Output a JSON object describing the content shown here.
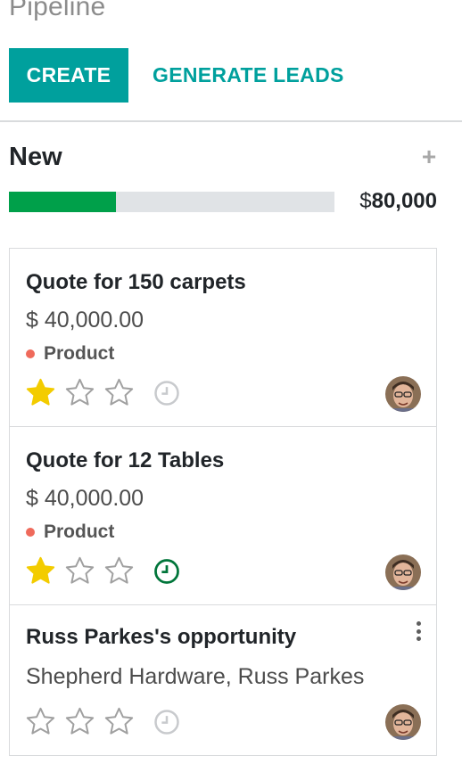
{
  "page": {
    "title": "Pipeline"
  },
  "toolbar": {
    "create_label": "CREATE",
    "generate_label": "GENERATE LEADS"
  },
  "column": {
    "title": "New",
    "add_icon": "plus-icon",
    "total_currency": "$",
    "total_amount": "80,000",
    "progress_fraction": 0.33,
    "progress_color": "#00a04a"
  },
  "cards": [
    {
      "title": "Quote for 150 carpets",
      "amount": "$ 40,000.00",
      "tag": "Product",
      "tag_color": "#ef6a5b",
      "stars_filled": 1,
      "stars_total": 3,
      "activity_status": "none",
      "activity_color": "#c8cacd"
    },
    {
      "title": "Quote for 12 Tables",
      "amount": "$ 40,000.00",
      "tag": "Product",
      "tag_color": "#ef6a5b",
      "stars_filled": 1,
      "stars_total": 3,
      "activity_status": "planned",
      "activity_color": "#00753a"
    },
    {
      "title": "Russ Parkes's opportunity",
      "subtitle": "Shepherd Hardware, Russ Parkes",
      "stars_filled": 0,
      "stars_total": 3,
      "activity_status": "none",
      "activity_color": "#c8cacd"
    }
  ],
  "colors": {
    "accent": "#00a09d",
    "star_filled": "#f3cc00",
    "star_empty": "#a0a0a0"
  }
}
